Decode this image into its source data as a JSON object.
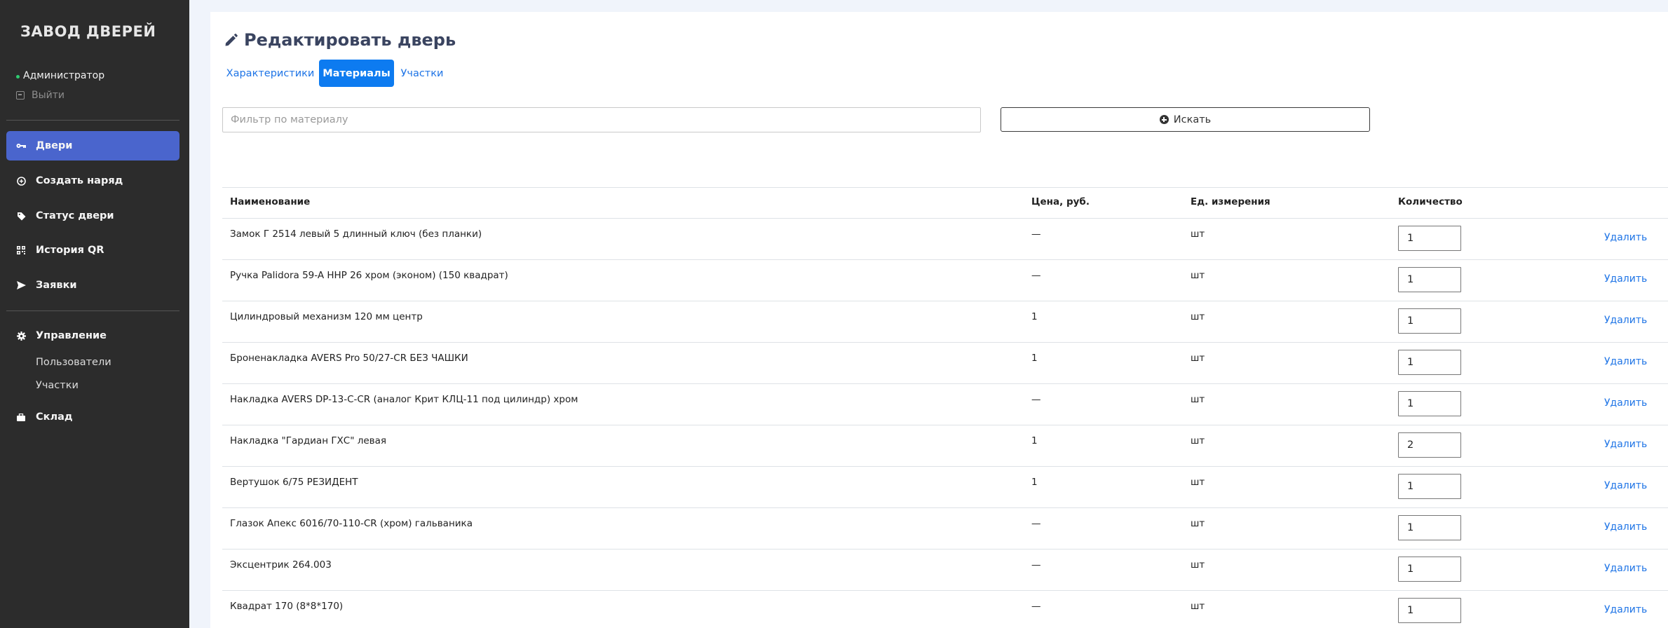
{
  "sidebar": {
    "brand": "ЗАВОД ДВЕРЕЙ",
    "user": "Администратор",
    "logout": "Выйти",
    "nav": [
      {
        "label": "Двери",
        "icon": "key-icon",
        "active": true
      },
      {
        "label": "Создать наряд",
        "icon": "plus-circle-icon",
        "active": false
      },
      {
        "label": "Статус двери",
        "icon": "tag-icon",
        "active": false
      },
      {
        "label": "История QR",
        "icon": "qr-code-icon",
        "active": false
      },
      {
        "label": "Заявки",
        "icon": "send-icon",
        "active": false
      }
    ],
    "admin": {
      "label": "Управление",
      "icon": "gear-icon",
      "items": [
        "Пользователи",
        "Участки"
      ]
    },
    "warehouse": {
      "label": "Склад",
      "icon": "briefcase-icon"
    }
  },
  "main": {
    "title": "Редактировать дверь",
    "tabs": [
      {
        "label": "Характеристики",
        "active": false
      },
      {
        "label": "Материалы",
        "active": true
      },
      {
        "label": "Участки",
        "active": false
      }
    ],
    "filter": {
      "placeholder": "Фильтр по материалу",
      "value": ""
    },
    "search_label": "Искать",
    "table": {
      "headers": [
        "Наименование",
        "Цена, руб.",
        "Ед. измерения",
        "Количество"
      ],
      "delete_label": "Удалить",
      "rows": [
        {
          "name": "Замок Г 2514 левый 5 длинный ключ (без планки)",
          "price": "—",
          "unit": "шт",
          "qty": "1"
        },
        {
          "name": "Ручка Palidora 59-A HHP 26 хром (эконом) (150 квадрат)",
          "price": "—",
          "unit": "шт",
          "qty": "1"
        },
        {
          "name": "Цилиндровый механизм 120 мм центр",
          "price": "1",
          "unit": "шт",
          "qty": "1"
        },
        {
          "name": "Броненакладка AVERS Pro 50/27-CR БЕЗ ЧАШКИ",
          "price": "1",
          "unit": "шт",
          "qty": "1"
        },
        {
          "name": "Накладка AVERS DP-13-C-CR (аналог Крит КЛЦ-11 под цилиндр) хром",
          "price": "—",
          "unit": "шт",
          "qty": "1"
        },
        {
          "name": "Накладка \"Гардиан ГХС\" левая",
          "price": "1",
          "unit": "шт",
          "qty": "2"
        },
        {
          "name": "Вертушок 6/75 РЕЗИДЕНТ",
          "price": "1",
          "unit": "шт",
          "qty": "1"
        },
        {
          "name": "Глазок Апекс 6016/70-110-CR (хром) гальваника",
          "price": "—",
          "unit": "шт",
          "qty": "1"
        },
        {
          "name": "Эксцентрик 264.003",
          "price": "—",
          "unit": "шт",
          "qty": "1"
        },
        {
          "name": "Квадрат 170 (8*8*170)",
          "price": "—",
          "unit": "шт",
          "qty": "1"
        }
      ]
    }
  },
  "colors": {
    "sidebar_bg": "#2c2c2c",
    "active_nav": "#4a65cd",
    "active_tab": "#0d7bf0",
    "link": "#1e74e6",
    "page_bg": "#f0f4fb"
  }
}
